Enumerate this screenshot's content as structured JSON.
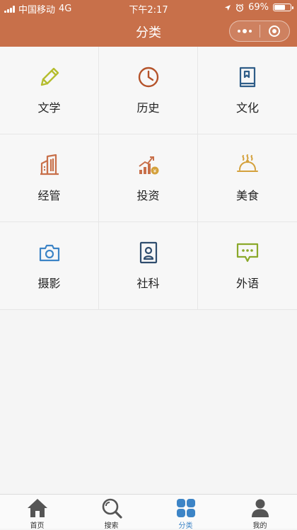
{
  "status_bar": {
    "carrier": "中国移动",
    "network": "4G",
    "time": "下午2:17",
    "battery": "69%",
    "battery_level": 0.69
  },
  "nav": {
    "title": "分类",
    "color": "#c8704a"
  },
  "categories": [
    {
      "label": "文学",
      "icon": "pencil-icon",
      "color": "#b5bd2e"
    },
    {
      "label": "历史",
      "icon": "clock-icon",
      "color": "#b5532a"
    },
    {
      "label": "文化",
      "icon": "book-icon",
      "color": "#2f5d88"
    },
    {
      "label": "经管",
      "icon": "building-icon",
      "color": "#c8704a"
    },
    {
      "label": "投资",
      "icon": "growth-chart-icon",
      "color": "#c8704a"
    },
    {
      "label": "美食",
      "icon": "food-cloche-icon",
      "color": "#d4a13c"
    },
    {
      "label": "摄影",
      "icon": "camera-icon",
      "color": "#3c84c6"
    },
    {
      "label": "社科",
      "icon": "id-badge-icon",
      "color": "#2f4d6e"
    },
    {
      "label": "外语",
      "icon": "chat-bubble-icon",
      "color": "#8aa82a"
    }
  ],
  "tabbar": {
    "items": [
      {
        "label": "首页",
        "icon": "home-icon"
      },
      {
        "label": "搜索",
        "icon": "search-icon"
      },
      {
        "label": "分类",
        "icon": "grid-icon",
        "active": true
      },
      {
        "label": "我的",
        "icon": "user-icon"
      }
    ],
    "active_color": "#3c84c6",
    "inactive_color": "#555555"
  }
}
